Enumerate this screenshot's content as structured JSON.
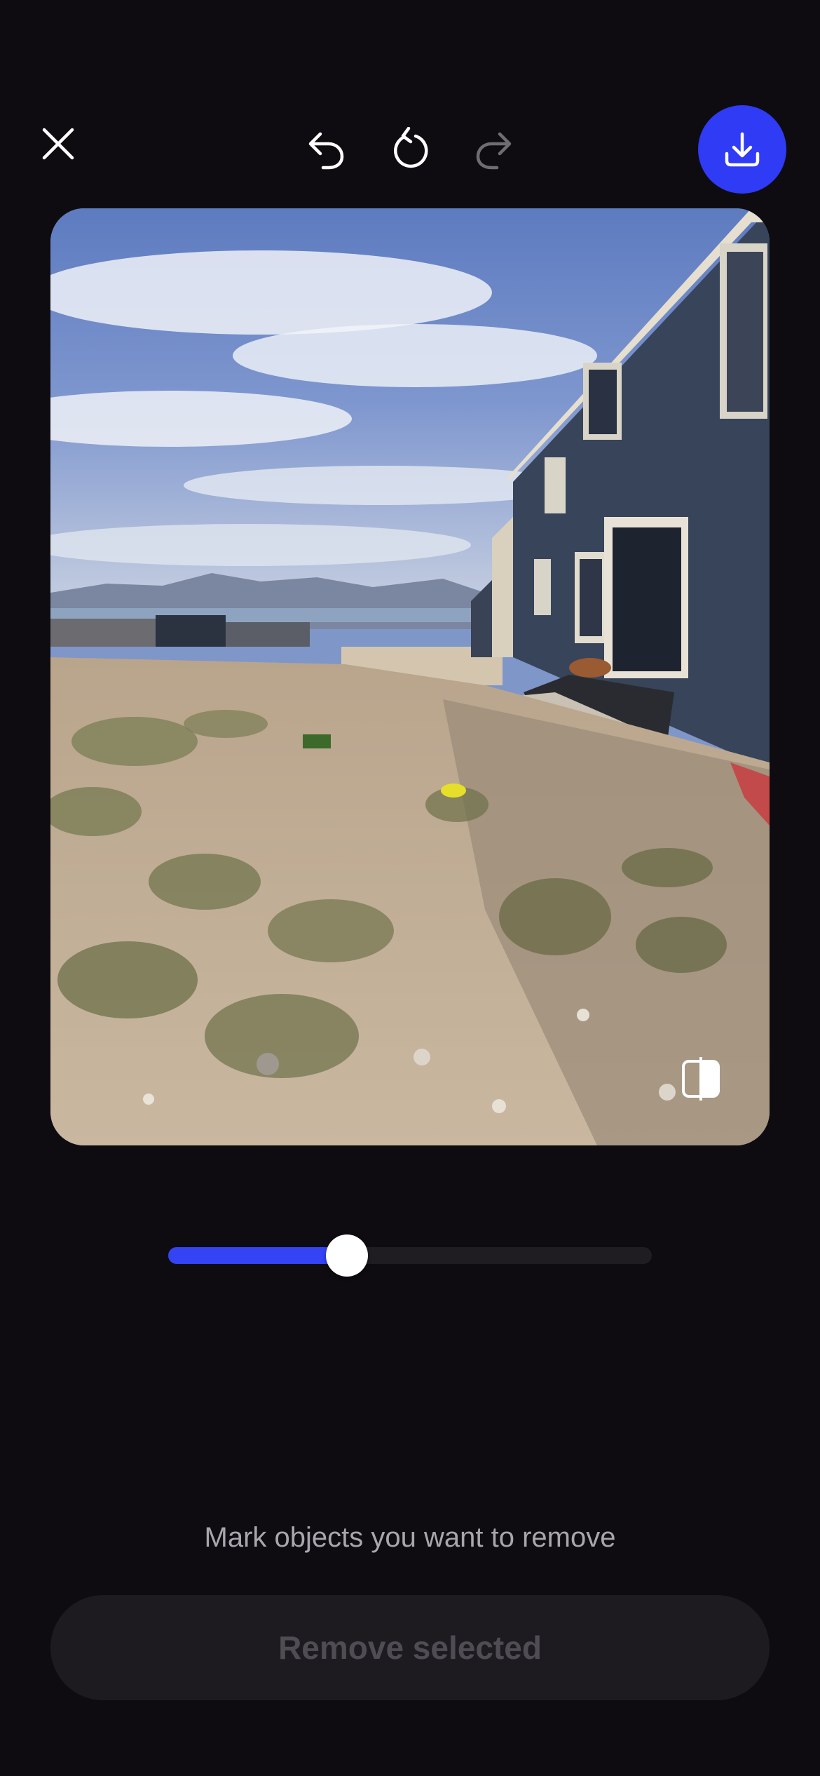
{
  "toolbar": {
    "close_icon": "close-icon",
    "undo_icon": "undo-icon",
    "reset_icon": "reset-icon",
    "redo_icon": "redo-icon",
    "redo_enabled": false,
    "download_icon": "download-icon",
    "accent_color": "#2f3bf5"
  },
  "editor": {
    "image_description_icon": "compare-icon",
    "brush_size_fraction": 0.37
  },
  "footer": {
    "hint": "Mark objects you want to remove",
    "remove_label": "Remove selected"
  }
}
